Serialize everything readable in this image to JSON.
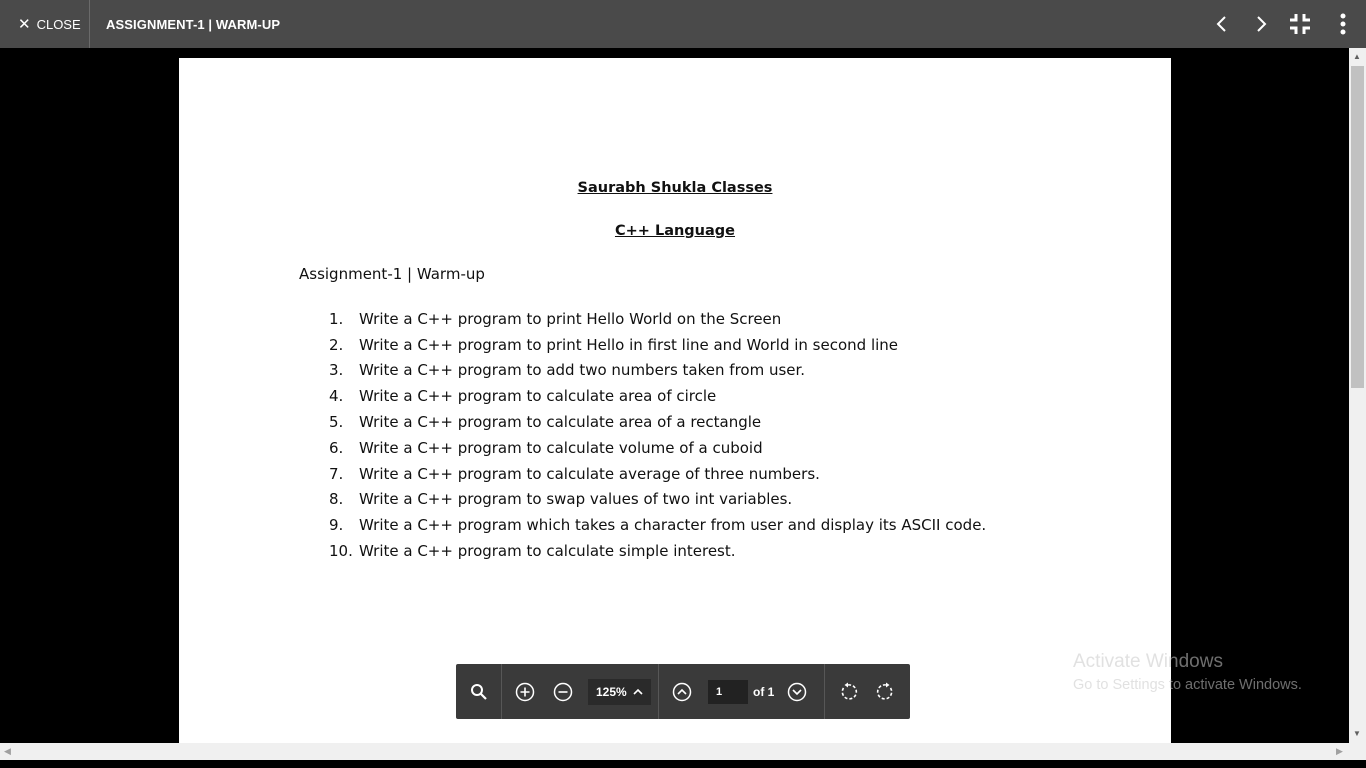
{
  "topbar": {
    "close_label": "CLOSE",
    "title": "ASSIGNMENT-1 | WARM-UP",
    "icons": [
      "chevron-left-icon",
      "chevron-right-icon",
      "exit-fullscreen-icon",
      "more-vertical-icon"
    ]
  },
  "document": {
    "heading1": "Saurabh Shukla Classes",
    "heading2": "C++ Language",
    "subtitle": "Assignment-1 | Warm-up",
    "items": [
      {
        "num": "1.",
        "text": "Write a C++ program to print Hello World on the Screen"
      },
      {
        "num": "2.",
        "text": "Write a C++ program to print Hello in first line and World in second line"
      },
      {
        "num": "3.",
        "text": "Write a C++ program to add two numbers taken from user."
      },
      {
        "num": "4.",
        "text": "Write a C++ program to calculate area of circle"
      },
      {
        "num": "5.",
        "text": "Write a C++ program to calculate area of a rectangle"
      },
      {
        "num": "6.",
        "text": "Write a C++ program to calculate volume of a cuboid"
      },
      {
        "num": "7.",
        "text": "Write a C++ program to calculate average of three numbers."
      },
      {
        "num": "8.",
        "text": "Write a C++ program to swap values of two int variables."
      },
      {
        "num": "9.",
        "text": "Write a C++ program which takes a character from user and display its ASCII code."
      },
      {
        "num": "10.",
        "text": "Write a C++ program to calculate simple interest."
      }
    ]
  },
  "toolbar": {
    "zoom": "125%",
    "page_value": "1",
    "page_total_label": "of 1",
    "icons": [
      "search-icon",
      "zoom-in-icon",
      "zoom-out-icon",
      "chevron-up-icon",
      "page-up-icon",
      "page-down-icon",
      "rotate-left-icon",
      "rotate-right-icon"
    ]
  },
  "watermark": {
    "line1": "Activate Windows",
    "line2": "Go to Settings to activate Windows."
  },
  "colors": {
    "topbar_bg": "#4a4a4a",
    "toolbar_bg": "#3a3a3a",
    "viewer_bg": "#000000",
    "page_bg": "#ffffff"
  }
}
